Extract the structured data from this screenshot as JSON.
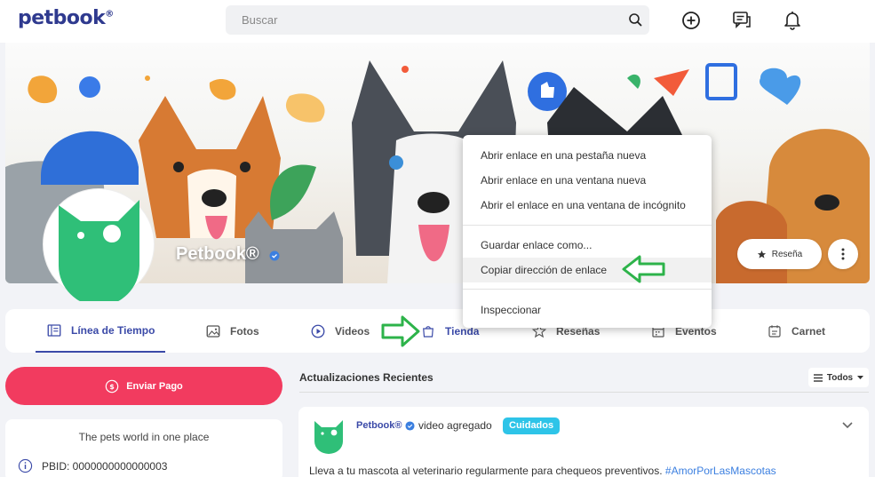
{
  "header": {
    "logo": "petbook",
    "logo_mark": "®",
    "search_placeholder": "Buscar",
    "icons": [
      "add-circle-icon",
      "chat-icon",
      "bell-icon"
    ]
  },
  "profile": {
    "name": "Petbook®",
    "review_label": "Reseña"
  },
  "tabs": [
    {
      "label": "Línea de Tiempo",
      "icon": "timeline-icon",
      "active": true
    },
    {
      "label": "Fotos",
      "icon": "photo-icon"
    },
    {
      "label": "Videos",
      "icon": "video-icon"
    },
    {
      "label": "Tienda",
      "icon": "shopping-bag-icon"
    },
    {
      "label": "Reseñas",
      "icon": "star-icon"
    },
    {
      "label": "Eventos",
      "icon": "calendar-icon"
    },
    {
      "label": "Carnet",
      "icon": "id-card-icon"
    }
  ],
  "sidebar": {
    "pay_label": "Enviar Pago",
    "tagline": "The pets world in one place",
    "pbid": "PBID: 0000000000000003"
  },
  "feed": {
    "title": "Actualizaciones Recientes",
    "filter_label": "Todos",
    "post": {
      "author": "Petbook®",
      "action": "video agregado",
      "badge": "Cuidados",
      "text": "Lleva a tu mascota al veterinario regularmente para chequeos preventivos.",
      "hashtag": "#AmorPorLasMascotas"
    }
  },
  "context_menu": {
    "items": [
      "Abrir enlace en una pestaña nueva",
      "Abrir enlace en una ventana nueva",
      "Abrir el enlace en una ventana de incógnito",
      "Guardar enlace como...",
      "Copiar dirección de enlace",
      "Inspeccionar"
    ],
    "highlighted": "Copiar dirección de enlace"
  },
  "colors": {
    "brand": "#2f3a8f",
    "accent": "#3b4aa8",
    "pay": "#f23b5f",
    "badge": "#2ec4e8",
    "avatar_green": "#2fbf78",
    "annotation_arrow": "#2db34a"
  }
}
